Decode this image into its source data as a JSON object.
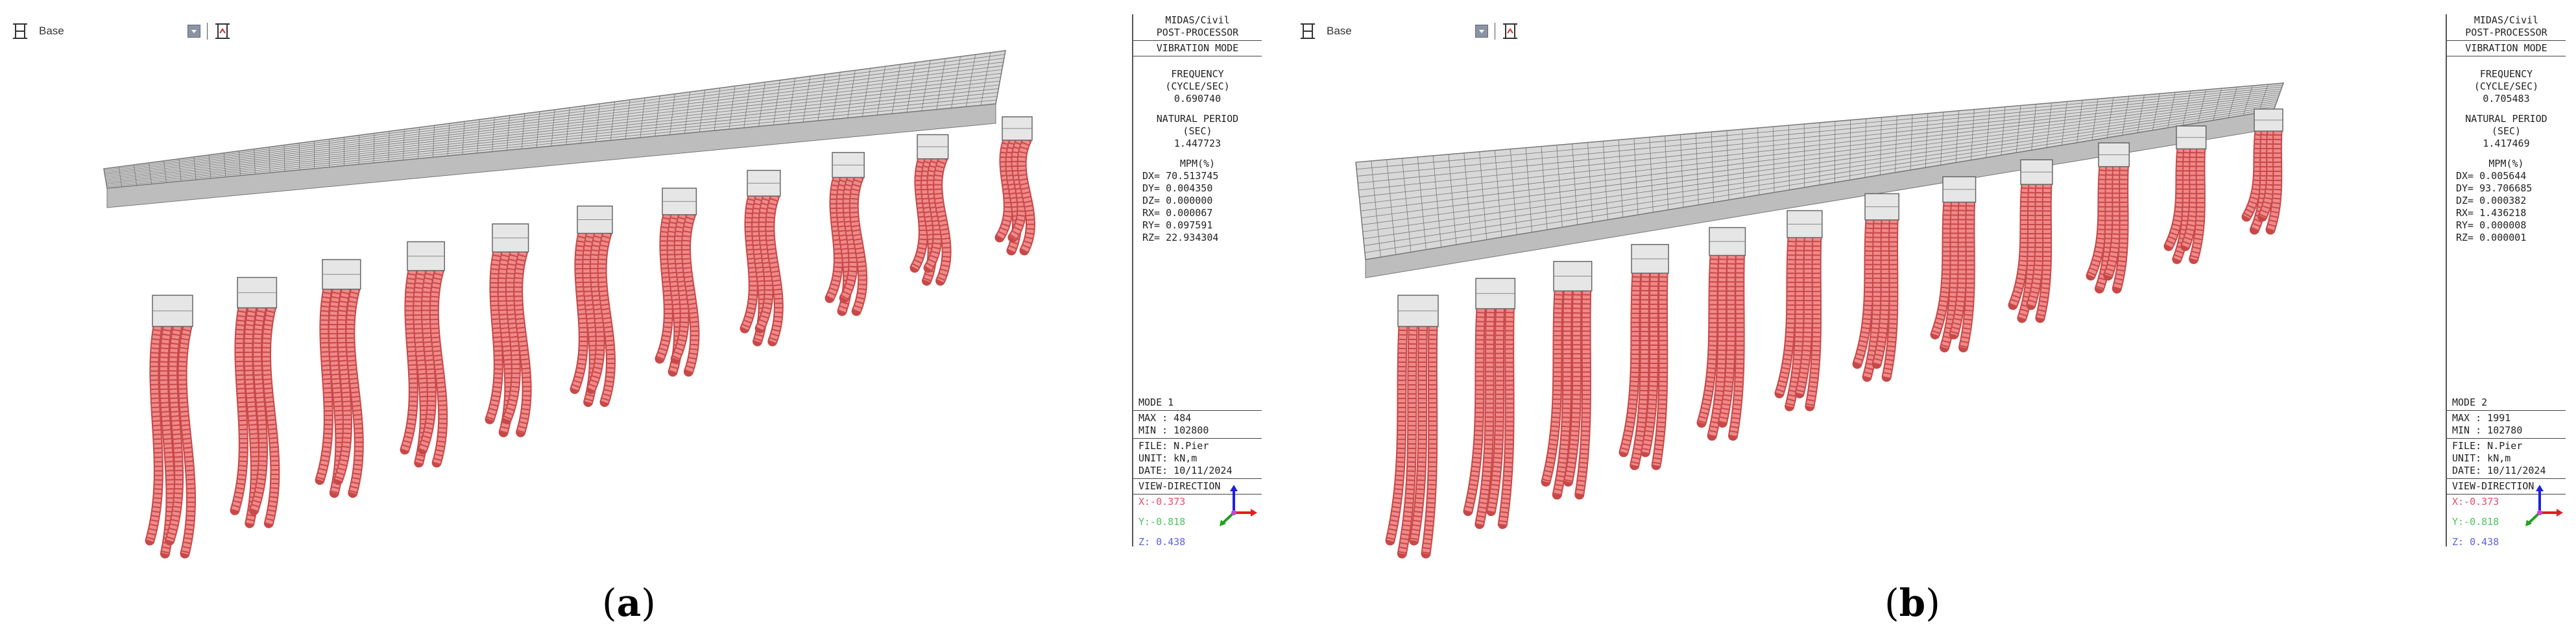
{
  "panels": [
    {
      "toolbar": {
        "base_label": "Base"
      },
      "info": {
        "program": "MIDAS/Civil",
        "module": "POST-PROCESSOR",
        "analysis": "VIBRATION MODE",
        "frequency_label": "FREQUENCY",
        "frequency_unit": "(CYCLE/SEC)",
        "frequency_value": "0.690740",
        "period_label": "NATURAL PERIOD",
        "period_unit": "(SEC)",
        "period_value": "1.447723",
        "mpm_label": "MPM(%)",
        "mpm": [
          {
            "key": "DX=",
            "value": "70.513745"
          },
          {
            "key": "DY=",
            "value": "0.004350"
          },
          {
            "key": "DZ=",
            "value": "0.000000"
          },
          {
            "key": "RX=",
            "value": "0.000067"
          },
          {
            "key": "RY=",
            "value": "0.097591"
          },
          {
            "key": "RZ=",
            "value": "22.934304"
          }
        ],
        "mode": "MODE 1",
        "max": "MAX : 484",
        "min": "MIN : 102800",
        "file": "FILE: N.Pier",
        "unit": "UNIT: kN,m",
        "date": "DATE: 10/11/2024",
        "view_direction": "VIEW-DIRECTION",
        "view_x": "X:-0.373",
        "view_y": "Y:-0.818",
        "view_z": "Z: 0.438"
      },
      "caption_letter": "a"
    },
    {
      "toolbar": {
        "base_label": "Base"
      },
      "info": {
        "program": "MIDAS/Civil",
        "module": "POST-PROCESSOR",
        "analysis": "VIBRATION MODE",
        "frequency_label": "FREQUENCY",
        "frequency_unit": "(CYCLE/SEC)",
        "frequency_value": "0.705483",
        "period_label": "NATURAL PERIOD",
        "period_unit": "(SEC)",
        "period_value": "1.417469",
        "mpm_label": "MPM(%)",
        "mpm": [
          {
            "key": "DX=",
            "value": "0.005644"
          },
          {
            "key": "DY=",
            "value": "93.706685"
          },
          {
            "key": "DZ=",
            "value": "0.000382"
          },
          {
            "key": "RX=",
            "value": "1.436218"
          },
          {
            "key": "RY=",
            "value": "0.000008"
          },
          {
            "key": "RZ=",
            "value": "0.000001"
          }
        ],
        "mode": "MODE 2",
        "max": "MAX : 1991",
        "min": "MIN : 102780",
        "file": "FILE: N.Pier",
        "unit": "UNIT: kN,m",
        "date": "DATE: 10/11/2024",
        "view_direction": "VIEW-DIRECTION",
        "view_x": "X:-0.373",
        "view_y": "Y:-0.818",
        "view_z": "Z: 0.438"
      },
      "caption_letter": "b"
    }
  ],
  "caption_open": "(",
  "caption_close": ")",
  "colors": {
    "pile": "#f08a8a",
    "pile_edge": "#c84848",
    "deck_grid": "#777777",
    "deck_fill": "#d8d8d8",
    "axis_x": "#e02020",
    "axis_y": "#20a020",
    "axis_z": "#2020e0"
  }
}
